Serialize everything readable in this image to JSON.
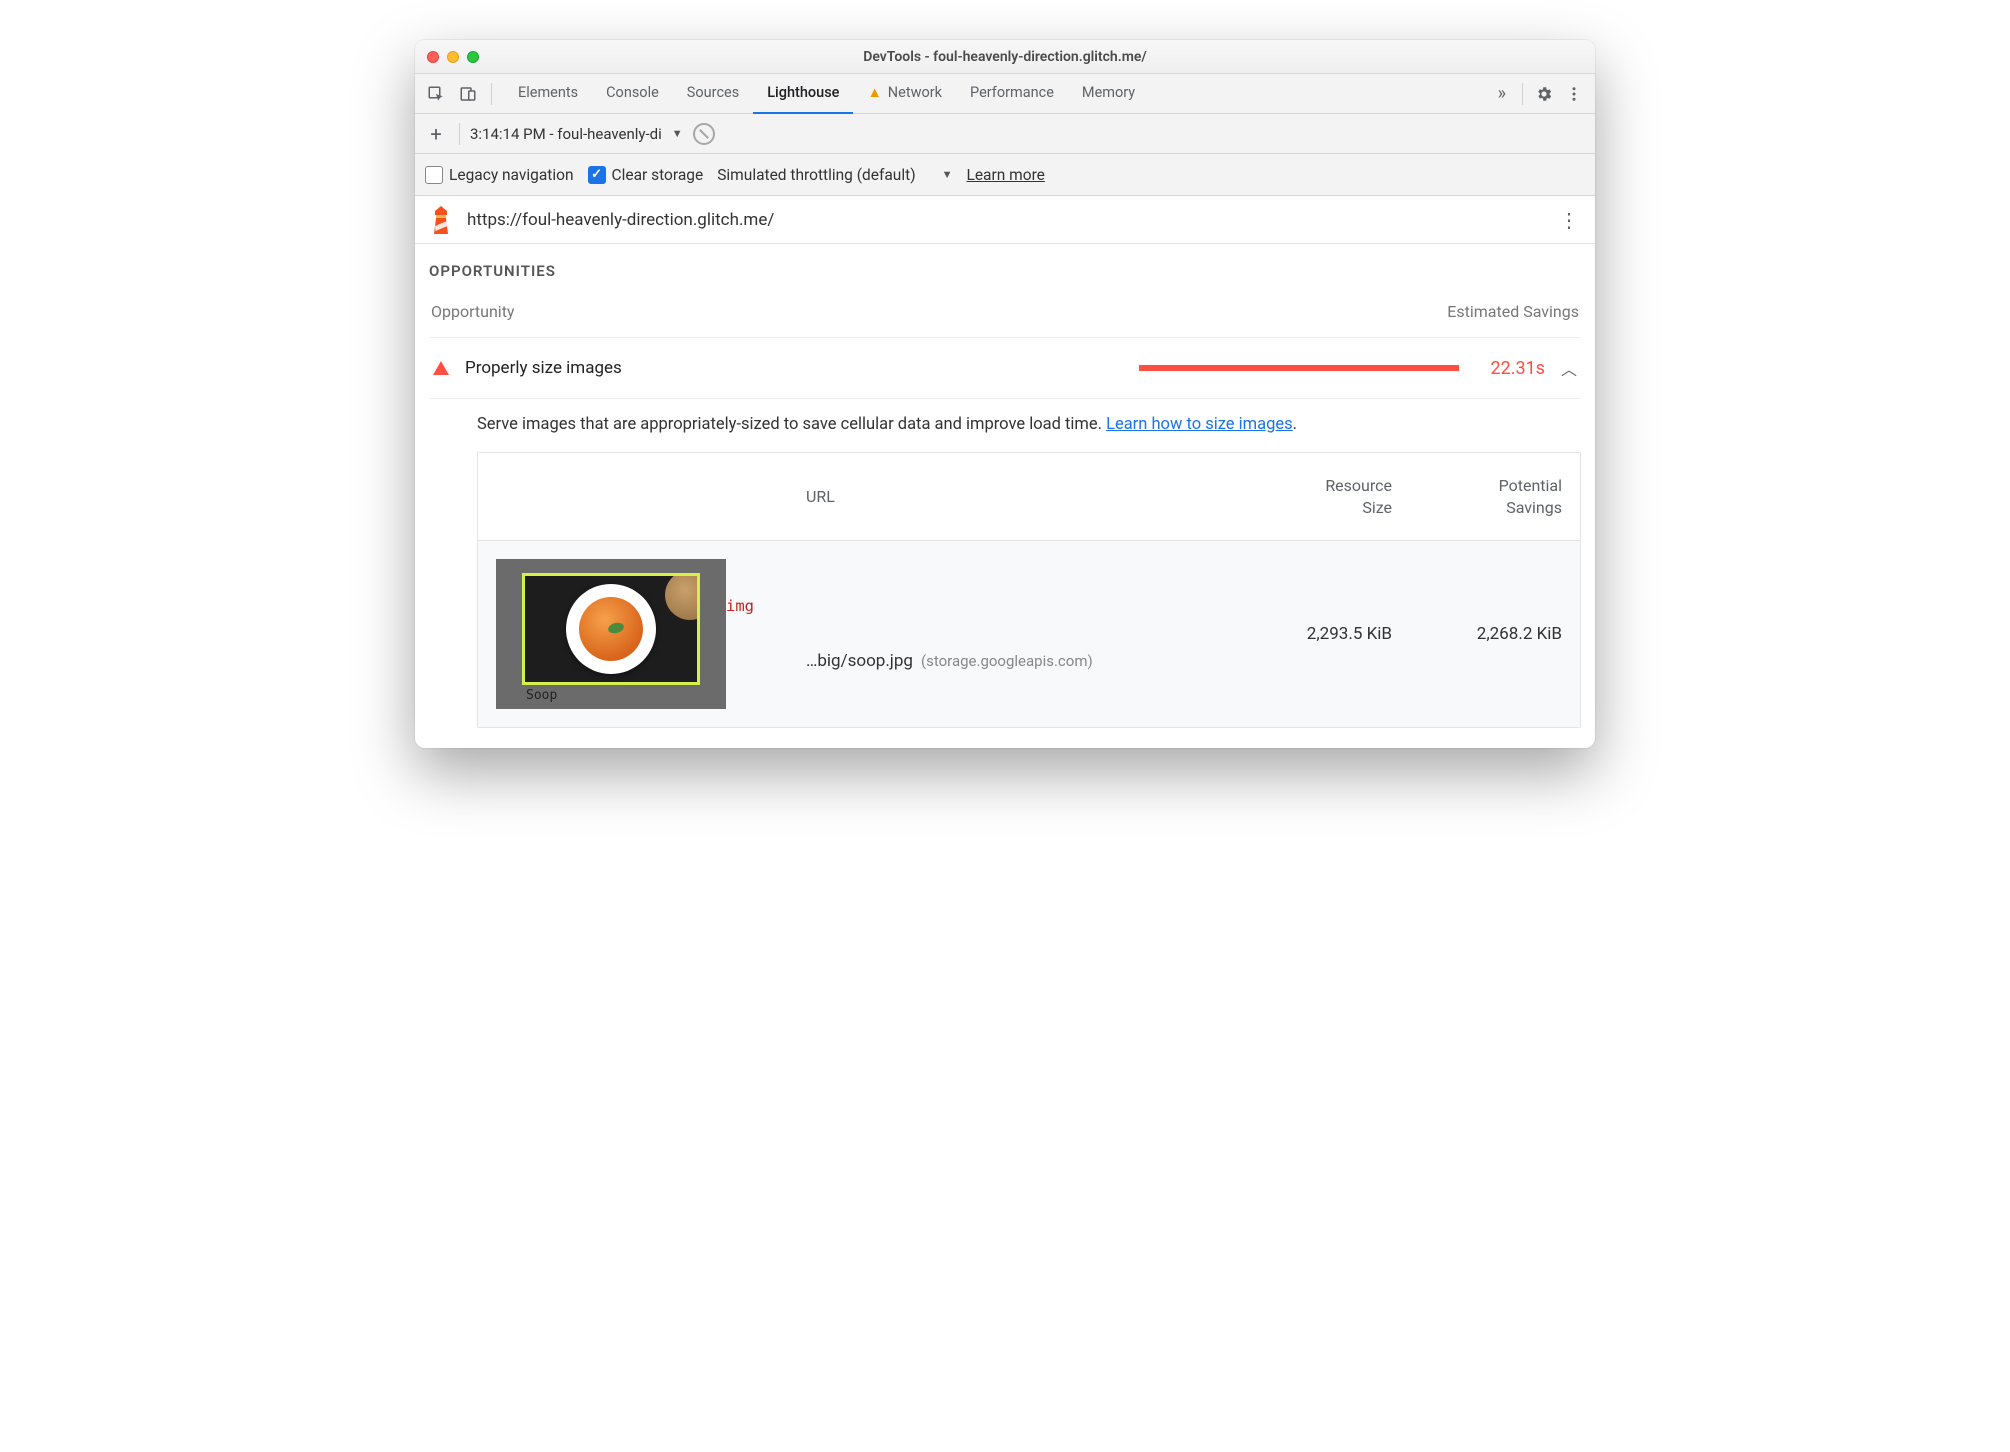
{
  "window": {
    "title": "DevTools - foul-heavenly-direction.glitch.me/"
  },
  "tabs": {
    "elements": "Elements",
    "console": "Console",
    "sources": "Sources",
    "lighthouse": "Lighthouse",
    "network": "Network",
    "performance": "Performance",
    "memory": "Memory"
  },
  "toolbar": {
    "run_label": "3:14:14 PM - foul-heavenly-di"
  },
  "optionsbar": {
    "legacy_label": "Legacy navigation",
    "clear_label": "Clear storage",
    "throttling_label": "Simulated throttling (default)",
    "learn_more": "Learn more"
  },
  "urlbar": {
    "url": "https://foul-heavenly-direction.glitch.me/"
  },
  "section": {
    "title": "OPPORTUNITIES",
    "col_opportunity": "Opportunity",
    "col_savings": "Estimated Savings"
  },
  "audit": {
    "title": "Properly size images",
    "savings": "22.31s",
    "desc_pre": "Serve images that are appropriately-sized to save cellular data and improve load time. ",
    "desc_link": "Learn how to size images",
    "desc_post": "."
  },
  "table": {
    "head_url": "URL",
    "head_size_l1": "Resource",
    "head_size_l2": "Size",
    "head_sav_l1": "Potential",
    "head_sav_l2": "Savings",
    "rows": [
      {
        "tag": "img",
        "path": "…big/soop.jpg",
        "host": "(storage.googleapis.com)",
        "size": "2,293.5 KiB",
        "savings": "2,268.2 KiB",
        "thumb_label": "Soop"
      }
    ]
  }
}
